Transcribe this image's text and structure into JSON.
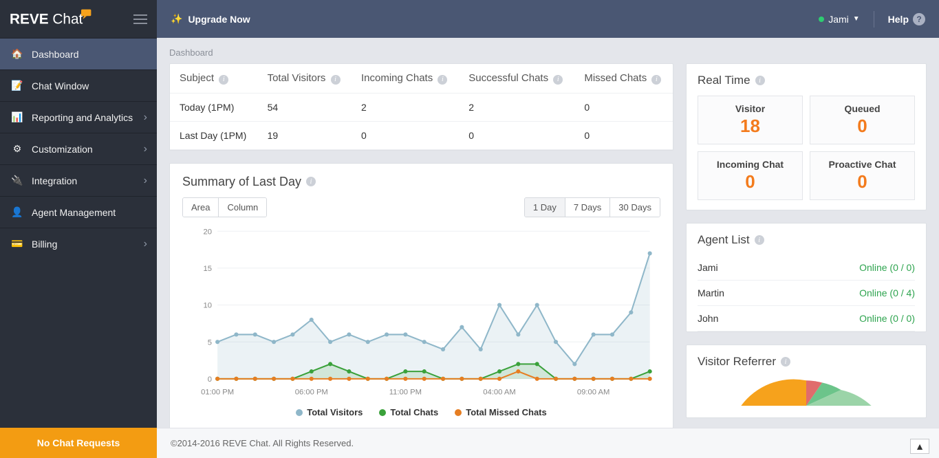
{
  "brand": "REVE Chat",
  "topbar": {
    "upgrade": "Upgrade Now",
    "user": "Jami",
    "help": "Help"
  },
  "breadcrumb": "Dashboard",
  "sidebar": {
    "items": [
      {
        "label": "Dashboard"
      },
      {
        "label": "Chat Window"
      },
      {
        "label": "Reporting and Analytics"
      },
      {
        "label": "Customization"
      },
      {
        "label": "Integration"
      },
      {
        "label": "Agent Management"
      },
      {
        "label": "Billing"
      }
    ],
    "footer": "No Chat Requests"
  },
  "stats": {
    "headers": [
      "Subject",
      "Total Visitors",
      "Incoming Chats",
      "Successful Chats",
      "Missed Chats"
    ],
    "rows": [
      {
        "subject": "Today (1PM)",
        "visitors": "54",
        "incoming": "2",
        "successful": "2",
        "missed": "0"
      },
      {
        "subject": "Last Day (1PM)",
        "visitors": "19",
        "incoming": "0",
        "successful": "0",
        "missed": "0"
      }
    ]
  },
  "summary": {
    "title": "Summary of Last Day",
    "view_btns": [
      "Area",
      "Column"
    ],
    "range_btns": [
      "1 Day",
      "7 Days",
      "30 Days"
    ],
    "legend": [
      "Total Visitors",
      "Total Chats",
      "Total Missed Chats"
    ]
  },
  "realtime": {
    "title": "Real Time",
    "cards": [
      {
        "label": "Visitor",
        "value": "18"
      },
      {
        "label": "Queued",
        "value": "0"
      },
      {
        "label": "Incoming Chat",
        "value": "0"
      },
      {
        "label": "Proactive Chat",
        "value": "0"
      }
    ]
  },
  "agents": {
    "title": "Agent List",
    "list": [
      {
        "name": "Jami",
        "status": "Online",
        "counts": "(0 / 0)"
      },
      {
        "name": "Martin",
        "status": "Online",
        "counts": "(0 / 4)"
      },
      {
        "name": "John",
        "status": "Online",
        "counts": "(0 / 0)"
      }
    ]
  },
  "referrer": {
    "title": "Visitor Referrer"
  },
  "copyright": "©2014-2016 REVE Chat. All Rights Reserved.",
  "chart_data": {
    "type": "line",
    "title": "Summary of Last Day",
    "xlabel": "",
    "ylabel": "",
    "ylim": [
      0,
      20
    ],
    "yticks": [
      0,
      5,
      10,
      15,
      20
    ],
    "x_tick_labels": [
      "01:00 PM",
      "06:00 PM",
      "11:00 PM",
      "04:00 AM",
      "09:00 AM"
    ],
    "categories": [
      "01:00 PM",
      "02:00 PM",
      "03:00 PM",
      "04:00 PM",
      "05:00 PM",
      "06:00 PM",
      "07:00 PM",
      "08:00 PM",
      "09:00 PM",
      "10:00 PM",
      "11:00 PM",
      "12:00 AM",
      "01:00 AM",
      "02:00 AM",
      "03:00 AM",
      "04:00 AM",
      "05:00 AM",
      "06:00 AM",
      "07:00 AM",
      "08:00 AM",
      "09:00 AM",
      "10:00 AM",
      "11:00 AM",
      "12:00 PM"
    ],
    "series": [
      {
        "name": "Total Visitors",
        "color": "#8fb7c9",
        "values": [
          5,
          6,
          6,
          5,
          6,
          8,
          5,
          6,
          5,
          6,
          6,
          5,
          4,
          7,
          4,
          10,
          6,
          10,
          5,
          2,
          6,
          6,
          9,
          17
        ]
      },
      {
        "name": "Total Chats",
        "color": "#3aa13a",
        "values": [
          0,
          0,
          0,
          0,
          0,
          1,
          2,
          1,
          0,
          0,
          1,
          1,
          0,
          0,
          0,
          1,
          2,
          2,
          0,
          0,
          0,
          0,
          0,
          1
        ]
      },
      {
        "name": "Total Missed Chats",
        "color": "#e67e22",
        "values": [
          0,
          0,
          0,
          0,
          0,
          0,
          0,
          0,
          0,
          0,
          0,
          0,
          0,
          0,
          0,
          0,
          1,
          0,
          0,
          0,
          0,
          0,
          0,
          0
        ]
      }
    ],
    "colors": {
      "visitors": "#8fb7c9",
      "chats": "#3aa13a",
      "missed": "#e67e22"
    }
  }
}
